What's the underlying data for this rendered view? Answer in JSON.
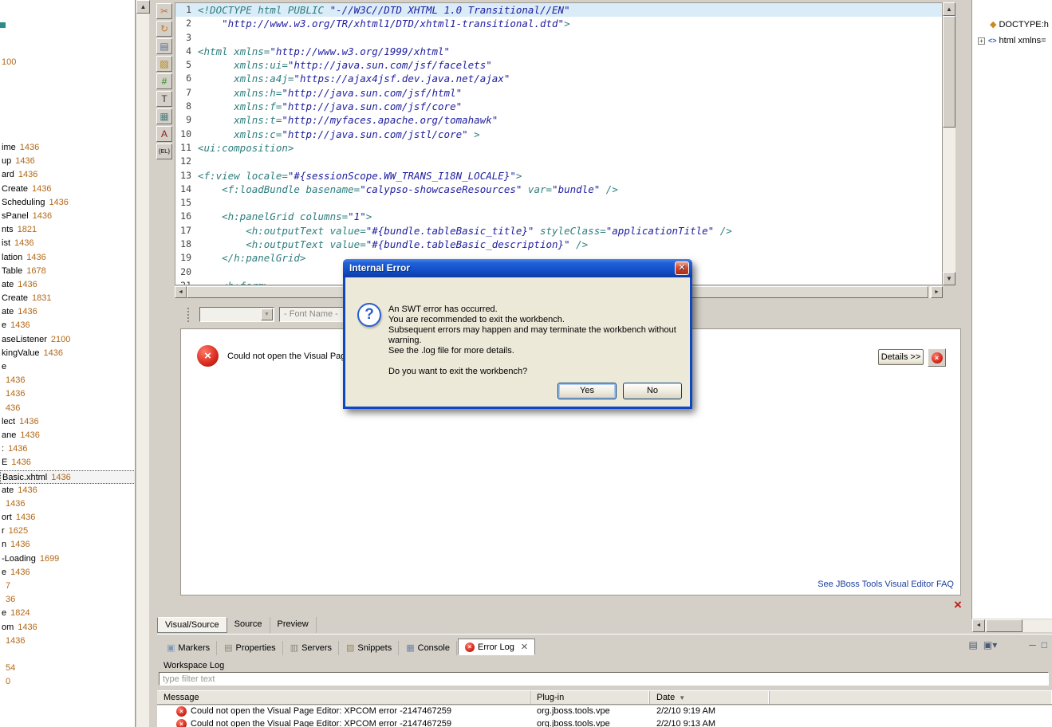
{
  "colors": {
    "accent_blue": "#1450c8",
    "error_red": "#d82a1e",
    "list_number": "#b26818",
    "code_string": "#2020a0",
    "code_tag": "#2e7d7d",
    "link_blue": "#1c3fa0"
  },
  "left_panel": {
    "top_value": "100",
    "selected_index": 24,
    "items": [
      {
        "label": "ime",
        "num": "1436"
      },
      {
        "label": "up",
        "num": "1436"
      },
      {
        "label": "ard",
        "num": "1436"
      },
      {
        "label": "Create",
        "num": "1436"
      },
      {
        "label": "Scheduling",
        "num": "1436"
      },
      {
        "label": "sPanel",
        "num": "1436"
      },
      {
        "label": "nts",
        "num": "1821"
      },
      {
        "label": "ist",
        "num": "1436"
      },
      {
        "label": "lation",
        "num": "1436"
      },
      {
        "label": "Table",
        "num": "1678"
      },
      {
        "label": "ate",
        "num": "1436"
      },
      {
        "label": "Create",
        "num": "1831"
      },
      {
        "label": "ate",
        "num": "1436"
      },
      {
        "label": "e",
        "num": "1436"
      },
      {
        "label": "aseListener",
        "num": "2100"
      },
      {
        "label": "kingValue",
        "num": "1436"
      },
      {
        "label": "e",
        "num": ""
      },
      {
        "label": "",
        "num": "1436"
      },
      {
        "label": "",
        "num": "1436"
      },
      {
        "label": "",
        "num": "436"
      },
      {
        "label": "lect",
        "num": "1436"
      },
      {
        "label": "ane",
        "num": "1436"
      },
      {
        "label": ":",
        "num": "1436"
      },
      {
        "label": "E",
        "num": "1436"
      },
      {
        "label": "Basic.xhtml",
        "num": "1436"
      },
      {
        "label": "ate",
        "num": "1436"
      },
      {
        "label": "",
        "num": "1436"
      },
      {
        "label": "ort",
        "num": "1436"
      },
      {
        "label": "r",
        "num": "1625"
      },
      {
        "label": "n",
        "num": "1436"
      },
      {
        "label": "-Loading",
        "num": "1699"
      },
      {
        "label": "e",
        "num": "1436"
      },
      {
        "label": "",
        "num": "7"
      },
      {
        "label": "",
        "num": "36"
      },
      {
        "label": "e",
        "num": "1824"
      },
      {
        "label": "om",
        "num": "1436"
      },
      {
        "label": "",
        "num": "1436"
      },
      {
        "label": "",
        "num": ""
      },
      {
        "label": "",
        "num": "54"
      },
      {
        "label": "",
        "num": "0"
      }
    ]
  },
  "vpe_toolbar": {
    "icons": [
      {
        "name": "cut-icon",
        "glyph": "✂",
        "color": "#c87137"
      },
      {
        "name": "refresh-icon",
        "glyph": "↻",
        "color": "#cc7a29"
      },
      {
        "name": "preview-icon",
        "glyph": "▤",
        "color": "#5b6f8f"
      },
      {
        "name": "export-icon",
        "glyph": "▨",
        "color": "#b8860b"
      },
      {
        "name": "bundle-icon",
        "glyph": "#",
        "color": "#2e8b2e"
      },
      {
        "name": "text-icon",
        "glyph": "T",
        "color": "#333333"
      },
      {
        "name": "image-icon",
        "glyph": "▦",
        "color": "#4f7f7f"
      },
      {
        "name": "style-icon",
        "glyph": "A",
        "color": "#8b1a1a"
      },
      {
        "name": "el-expression-icon",
        "glyph": "{EL}",
        "color": "#444444",
        "tiny": true
      }
    ]
  },
  "editor": {
    "selected_line": 1,
    "lines": [
      "<!DOCTYPE html PUBLIC \"-//W3C//DTD XHTML 1.0 Transitional//EN\"",
      "    \"http://www.w3.org/TR/xhtml1/DTD/xhtml1-transitional.dtd\">",
      "",
      "<html xmlns=\"http://www.w3.org/1999/xhtml\"",
      "      xmlns:ui=\"http://java.sun.com/jsf/facelets\"",
      "      xmlns:a4j=\"https://ajax4jsf.dev.java.net/ajax\"",
      "      xmlns:h=\"http://java.sun.com/jsf/html\"",
      "      xmlns:f=\"http://java.sun.com/jsf/core\"",
      "      xmlns:t=\"http://myfaces.apache.org/tomahawk\"",
      "      xmlns:c=\"http://java.sun.com/jstl/core\" >",
      "<ui:composition>",
      "",
      "<f:view locale=\"#{sessionScope.WW_TRANS_I18N_LOCALE}\">",
      "    <f:loadBundle basename=\"calypso-showcaseResources\" var=\"bundle\" />",
      "",
      "    <h:panelGrid columns=\"1\">",
      "        <h:outputText value=\"#{bundle.tableBasic_title}\" styleClass=\"applicationTitle\" />",
      "        <h:outputText value=\"#{bundle.tableBasic_description}\" />",
      "    </h:panelGrid>",
      "",
      "    <h:form>"
    ]
  },
  "format_bar": {
    "font_combo": "- Font Name -"
  },
  "vpe_error": {
    "message": "Could not open the Visual Page Editor: XPCOM error -2147467259",
    "details_label": "Details >>",
    "faq_link": "See JBoss Tools Visual Editor FAQ"
  },
  "dialog": {
    "title": "Internal Error",
    "close_label": "X",
    "lines": [
      "An SWT error has occurred.",
      "You are recommended to exit the workbench.",
      "Subsequent errors may happen and may terminate the workbench without warning.",
      "See the .log file for more details."
    ],
    "question": "Do you want to exit the workbench?",
    "yes_label": "Yes",
    "no_label": "No"
  },
  "editor_tabs": {
    "selected": 0,
    "items": [
      "Visual/Source",
      "Source",
      "Preview"
    ]
  },
  "bottom_panel": {
    "tabs": [
      {
        "label": "Markers",
        "icon": "markers-icon",
        "glyph": "▣",
        "color": "#7d97b8"
      },
      {
        "label": "Properties",
        "icon": "properties-icon",
        "glyph": "▤",
        "color": "#8a8878"
      },
      {
        "label": "Servers",
        "icon": "servers-icon",
        "glyph": "▥",
        "color": "#8a8878"
      },
      {
        "label": "Snippets",
        "icon": "snippets-icon",
        "glyph": "▧",
        "color": "#9a8a5a"
      },
      {
        "label": "Console",
        "icon": "console-icon",
        "glyph": "▦",
        "color": "#6a86a8"
      },
      {
        "label": "Error Log",
        "icon": "error-log-icon",
        "glyph": "",
        "color": "#cc2222",
        "selected": true,
        "closable": true
      }
    ],
    "toolbar_icons": [
      {
        "name": "open-log-icon",
        "glyph": "▤"
      },
      {
        "name": "view-menu-icon",
        "glyph": "▣▾"
      },
      {
        "name": "minimize-icon",
        "glyph": "─"
      },
      {
        "name": "maximize-icon",
        "glyph": "□"
      }
    ],
    "section_title": "Workspace Log",
    "filter_placeholder": "type filter text",
    "table": {
      "headers": [
        "Message",
        "Plug-in",
        "Date"
      ],
      "sort_column": "Date",
      "rows": [
        {
          "message": "Could not open the Visual Page Editor: XPCOM error -2147467259",
          "plugin": "org.jboss.tools.vpe",
          "date": "2/2/10 9:19 AM"
        },
        {
          "message": "Could not open the Visual Page Editor: XPCOM error -2147467259",
          "plugin": "org.jboss.tools.vpe",
          "date": "2/2/10 9:13 AM"
        }
      ]
    }
  },
  "outline": {
    "items": [
      {
        "label": "DOCTYPE:h",
        "icon": "doctype-icon",
        "expander": false
      },
      {
        "label": "html xmlns=",
        "icon": "html-tag-icon",
        "expander": true
      }
    ]
  }
}
